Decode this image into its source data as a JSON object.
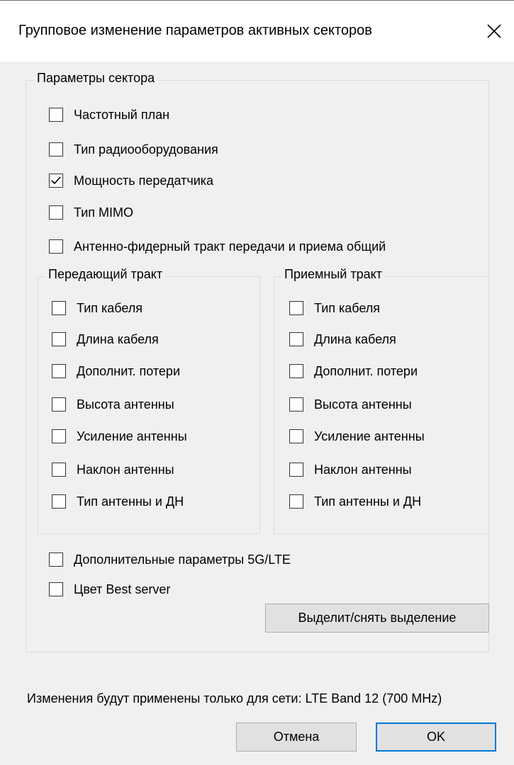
{
  "dialog": {
    "title": "Групповое изменение параметров активных секторов",
    "close_glyph": "✕"
  },
  "sector_params": {
    "label": "Параметры сектора",
    "items": [
      {
        "label": "Частотный план",
        "checked": false
      },
      {
        "label": "Тип радиооборудования",
        "checked": false
      },
      {
        "label": "Мощность передатчика",
        "checked": true
      },
      {
        "label": "Тип MIMO",
        "checked": false
      },
      {
        "label": "Антенно-фидерный тракт передачи и приема общий",
        "checked": false
      }
    ]
  },
  "tx_path": {
    "label": "Передающий тракт",
    "items": [
      {
        "label": "Тип кабеля",
        "checked": false
      },
      {
        "label": "Длина кабеля",
        "checked": false
      },
      {
        "label": "Дополнит. потери",
        "checked": false
      },
      {
        "label": "Высота антенны",
        "checked": false
      },
      {
        "label": "Усиление антенны",
        "checked": false
      },
      {
        "label": "Наклон антенны",
        "checked": false
      },
      {
        "label": "Тип антенны и ДН",
        "checked": false
      }
    ]
  },
  "rx_path": {
    "label": "Приемный тракт",
    "items": [
      {
        "label": "Тип кабеля",
        "checked": false
      },
      {
        "label": "Длина кабеля",
        "checked": false
      },
      {
        "label": "Дополнит. потери",
        "checked": false
      },
      {
        "label": "Высота антенны",
        "checked": false
      },
      {
        "label": "Усиление антенны",
        "checked": false
      },
      {
        "label": "Наклон антенны",
        "checked": false
      },
      {
        "label": "Тип антенны и ДН",
        "checked": false
      }
    ]
  },
  "extra": {
    "items": [
      {
        "label": "Дополнительные параметры 5G/LTE",
        "checked": false
      },
      {
        "label": "Цвет Best server",
        "checked": false
      }
    ]
  },
  "toggle_selection_label": "Выделит/снять выделение",
  "note": "Изменения будут применены только для сети: LTE Band 12 (700 MHz)",
  "buttons": {
    "cancel": "Отмена",
    "ok": "OK"
  }
}
